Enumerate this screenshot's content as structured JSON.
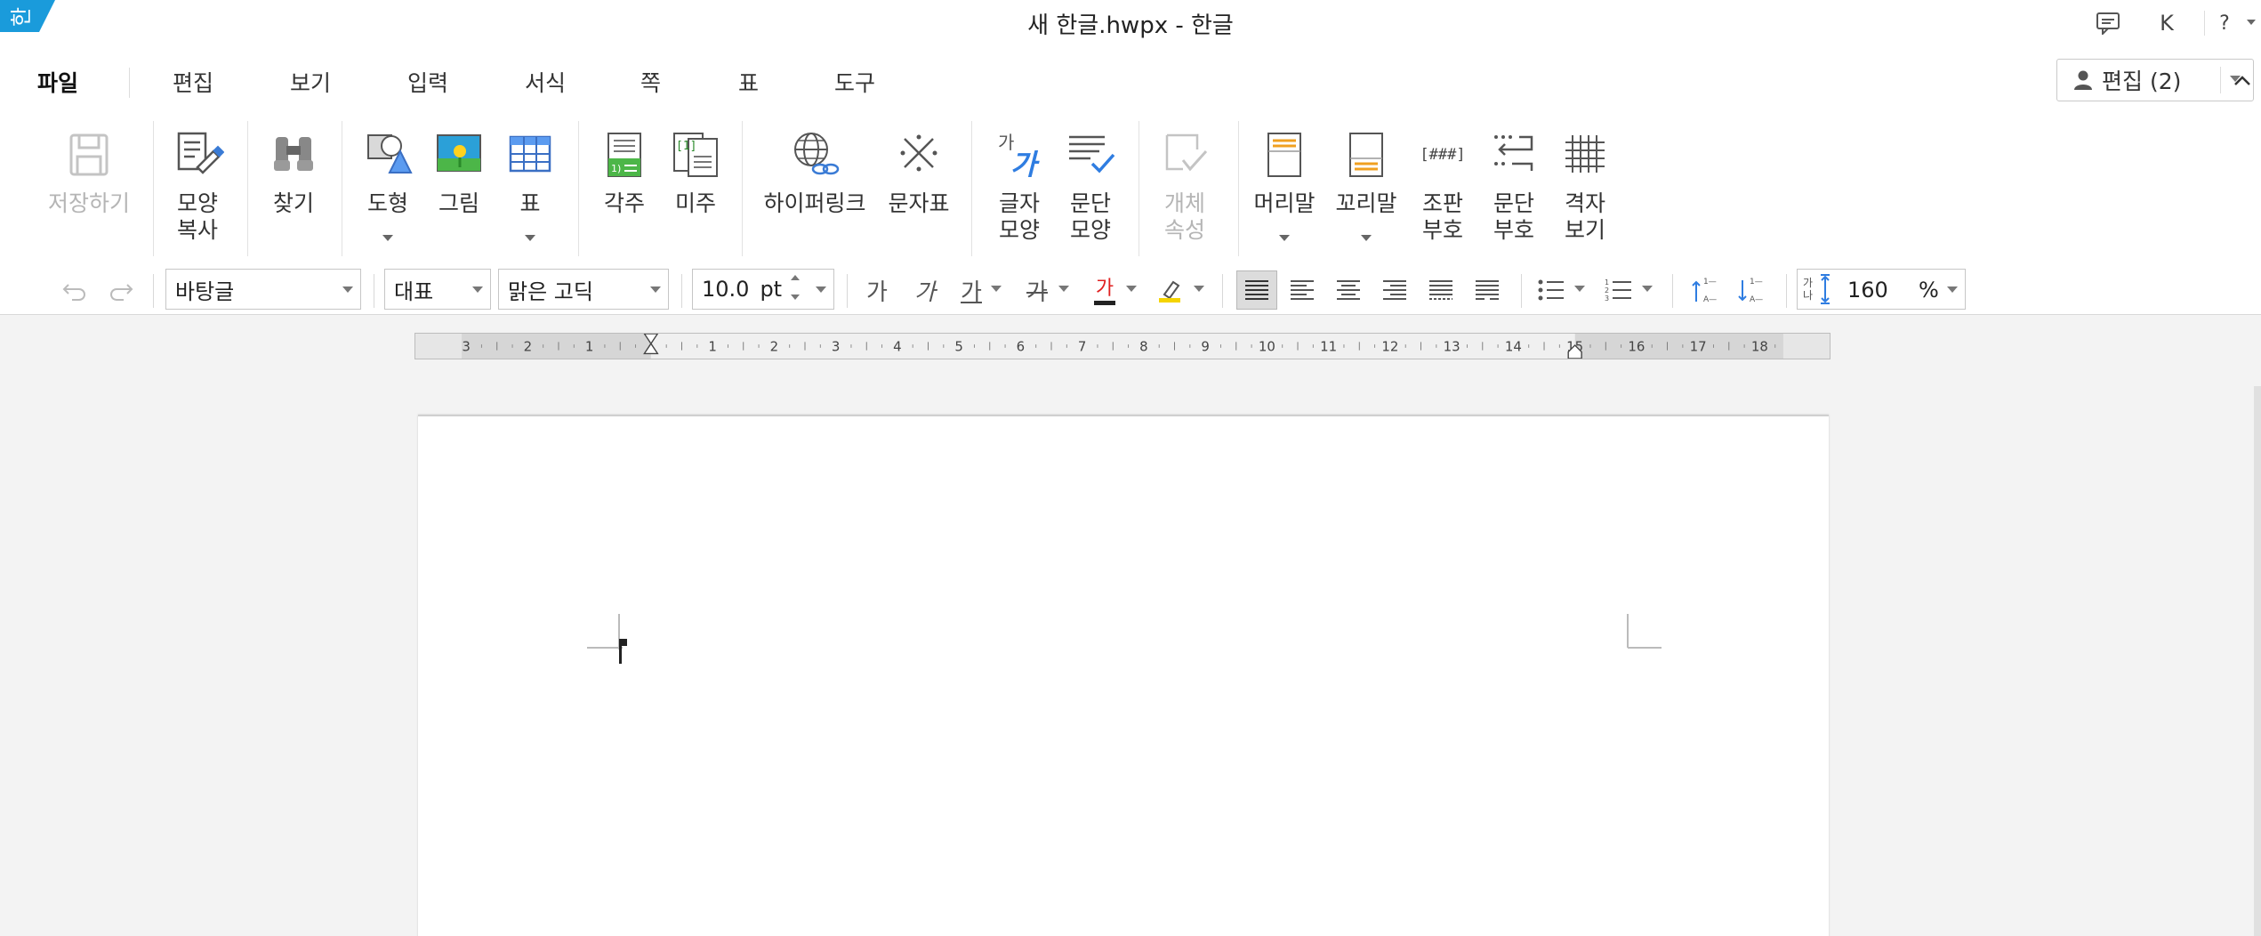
{
  "app": {
    "title": "새 한글.hwpx - 한글",
    "logo_text": "한"
  },
  "titlebar": {
    "comment_icon": "comment-icon",
    "account_initial": "K",
    "help_label": "?"
  },
  "menu": {
    "tabs": [
      "파일",
      "편집",
      "보기",
      "입력",
      "서식",
      "쪽",
      "표",
      "도구"
    ],
    "active_tab": "파일",
    "edit_mode_label": "편집 (2)"
  },
  "ribbon": {
    "save": "저장하기",
    "copy_format": "모양\n복사",
    "find": "찾기",
    "shape": "도형",
    "picture": "그림",
    "table": "표",
    "footnote": "각주",
    "endnote": "미주",
    "hyperlink": "하이퍼링크",
    "char_map": "문자표",
    "char_shape": "글자\n모양",
    "para_shape": "문단\n모양",
    "object_props": "개체\n속성",
    "header": "머리말",
    "footer": "꼬리말",
    "layout_marks": "조판\n부호",
    "para_marks": "문단\n부호",
    "grid_view": "격자\n보기",
    "char_shape_icon_top": "가",
    "char_shape_icon_main": "가",
    "layout_marks_icon": "[###]"
  },
  "formatbar": {
    "style": "바탕글",
    "lang": "대표",
    "font": "맑은 고딕",
    "size": "10.0",
    "size_unit": "pt",
    "bold_glyph": "가",
    "italic_glyph": "가",
    "underline_glyph": "가",
    "strike_glyph": "가",
    "color_glyph": "가",
    "line_spacing": "160",
    "line_spacing_unit": "%",
    "line_spacing_icon_text": "가나"
  },
  "ruler": {
    "labels": [
      "3",
      "2",
      "1",
      "1",
      "2",
      "3",
      "4",
      "5",
      "6",
      "7",
      "8",
      "9",
      "10",
      "11",
      "12",
      "13",
      "14",
      "15",
      "16",
      "17",
      "18"
    ]
  },
  "colors": {
    "accent": "#1a9bdb",
    "font_color_bar": "#e02020",
    "highlight_bar": "#f5d400",
    "disabled": "#b5b5b5"
  }
}
